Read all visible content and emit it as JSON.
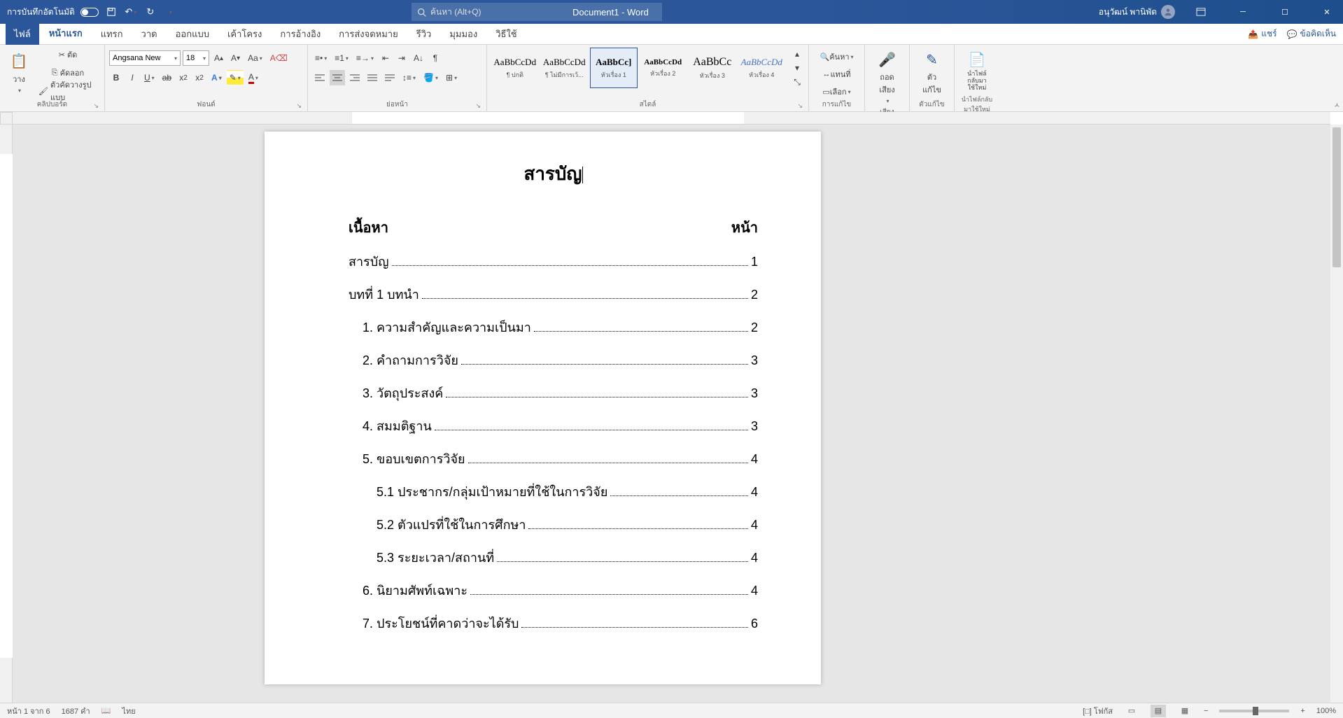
{
  "titlebar": {
    "autosave": "การบันทึกอัตโนมัติ",
    "doc_title": "Document1  -  Word",
    "search_placeholder": "ค้นหา (Alt+Q)",
    "user_name": "อนุวัฒน์ พานิพัด"
  },
  "tabs": {
    "file": "ไฟล์",
    "home": "หน้าแรก",
    "insert": "แทรก",
    "draw": "วาด",
    "design": "ออกแบบ",
    "layout": "เค้าโครง",
    "references": "การอ้างอิง",
    "mailings": "การส่งจดหมาย",
    "review": "รีวิว",
    "view": "มุมมอง",
    "help": "วิธีใช้",
    "share": "แชร์",
    "comments": "ข้อคิดเห็น"
  },
  "ribbon": {
    "clipboard": {
      "label": "คลิปบอร์ด",
      "paste": "วาง",
      "cut": "ตัด",
      "copy": "คัดลอก",
      "format_painter": "ตัวคัดวางรูปแบบ"
    },
    "font": {
      "label": "ฟอนด์",
      "name": "Angsana New",
      "size": "18"
    },
    "paragraph": {
      "label": "ย่อหน้า"
    },
    "styles": {
      "label": "สไตล์",
      "s1": {
        "preview": "AaBbCcDd",
        "name": "¶ ปกติ"
      },
      "s2": {
        "preview": "AaBbCcDd",
        "name": "¶ ไม่มีการเว้..."
      },
      "s3": {
        "preview": "AaBbCc]",
        "name": "หัวเรื่อง 1"
      },
      "s4": {
        "preview": "AaBbCcDd",
        "name": "หัวเรื่อง 2"
      },
      "s5": {
        "preview": "AaBbCc",
        "name": "หัวเรื่อง 3"
      },
      "s6": {
        "preview": "AaBbCcDd",
        "name": "หัวเรื่อง 4"
      }
    },
    "editing": {
      "label": "การแก้ไข",
      "find": "ค้นหา",
      "replace": "แทนที่",
      "select": "เลือก"
    },
    "voice": {
      "label": "เสียง",
      "dictate": "ถอดเสียง"
    },
    "editor": {
      "label": "ตัวแก้ไข",
      "editor_btn": "ตัวแก้ไข"
    },
    "reuse": {
      "label": "นำไฟล์กลับมาใช้ใหม่",
      "reuse_btn": "นำไฟล์กลับมาใช้ใหม่"
    }
  },
  "doc": {
    "title": "สารบัญ",
    "col_content": "เนื้อหา",
    "col_page": "หน้า",
    "lines": [
      {
        "txt": "สารบัญ",
        "pg": "1",
        "indent": 0
      },
      {
        "txt": "บทที่ 1 บทนำ",
        "pg": "2",
        "indent": 0
      },
      {
        "txt": "1.    ความสำคัญและความเป็นมา",
        "pg": "2",
        "indent": 1
      },
      {
        "txt": "2.    คำถามการวิจัย",
        "pg": "3",
        "indent": 1
      },
      {
        "txt": "3.    วัตถุประสงค์",
        "pg": "3",
        "indent": 1
      },
      {
        "txt": "4.    สมมติฐาน",
        "pg": "3",
        "indent": 1
      },
      {
        "txt": "5.    ขอบเขตการวิจัย",
        "pg": "4",
        "indent": 1
      },
      {
        "txt": "5.1 ประชากร/กลุ่มเป้าหมายที่ใช้ในการวิจัย",
        "pg": "4",
        "indent": 2
      },
      {
        "txt": "5.2 ตัวแปรที่ใช้ในการศึกษา",
        "pg": "4",
        "indent": 2
      },
      {
        "txt": "5.3 ระยะเวลา/สถานที่",
        "pg": "4",
        "indent": 2
      },
      {
        "txt": "6.    นิยามศัพท์เฉพาะ",
        "pg": "4",
        "indent": 1
      },
      {
        "txt": "7.    ประโยชน์ที่คาดว่าจะได้รับ",
        "pg": "6",
        "indent": 1
      }
    ]
  },
  "statusbar": {
    "page": "หน้า 1 จาก 6",
    "words": "1687 คำ",
    "lang": "ไทย",
    "focus": "โฟกัส",
    "zoom": "100%"
  }
}
